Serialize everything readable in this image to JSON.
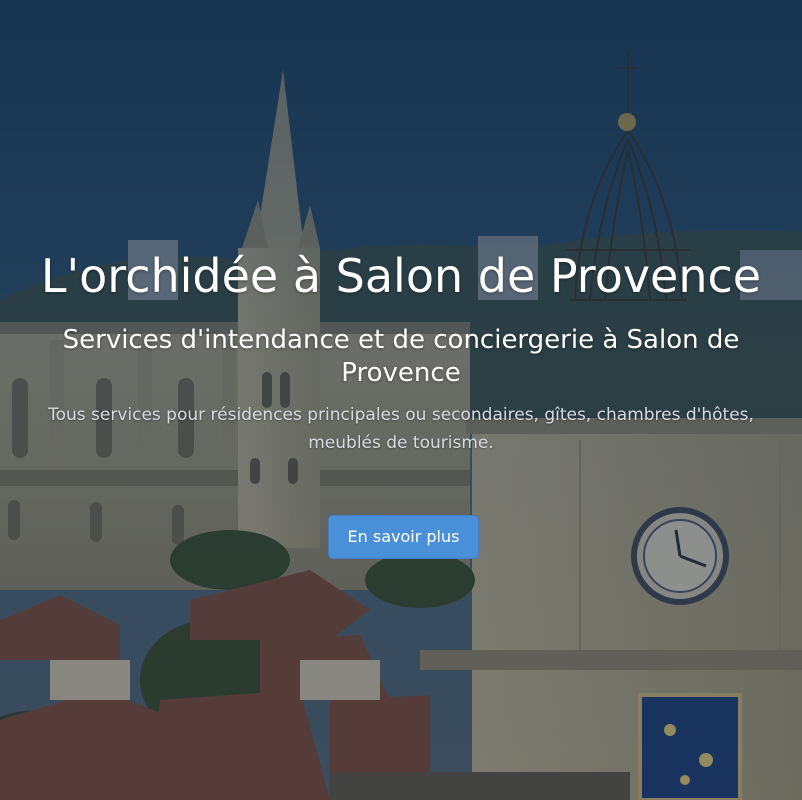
{
  "hero": {
    "title": "L'orchidée à Salon de Provence",
    "subtitle": "Services d'intendance et de conciergerie à Salon de Provence",
    "lead": "Tous services pour résidences principales ou secondaires, gîtes, chambres d'hôtes, meublés de tourisme.",
    "button_label": "En savoir plus",
    "background_image": "salon-de-provence-church-and-clock-tower",
    "colors": {
      "button": "#4a90d9",
      "overlay": "#1c3a58",
      "sky": "#274a6b"
    }
  }
}
